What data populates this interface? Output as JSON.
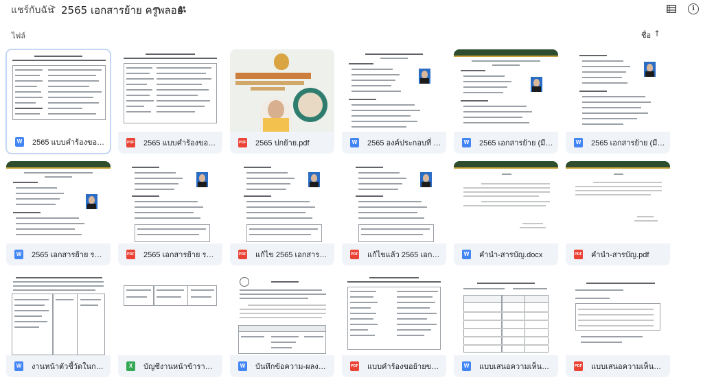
{
  "breadcrumb": {
    "root": "แชร์กับฉัน",
    "separator": ">",
    "current": "2565 เอกสารย้าย ครูพลอย"
  },
  "toolbar": {
    "shared_icon": "people-icon",
    "view_icon": "list-view-icon",
    "info_icon": "info-icon",
    "info_glyph": "i"
  },
  "section": {
    "label": "ไฟล์",
    "sort_label": "ชื่อ",
    "sort_arrow": "↑"
  },
  "file_types": {
    "doc": "W",
    "pdf": "PDF",
    "xls": "X"
  },
  "colors": {
    "doc": "#4285f4",
    "pdf": "#ea4335",
    "xls": "#34a853",
    "selected_border": "#c2d6f5"
  },
  "files": [
    {
      "name": "2565 แบบคำร้องขอย้ายของ...",
      "type": "W"
    },
    {
      "name": "2565 แบบคำร้องขอย้ายของ...",
      "type": "PDF"
    },
    {
      "name": "2565 ปกย้าย.pdf",
      "type": "PDF"
    },
    {
      "name": "2565 องค์ประกอบที่ 1-7 ครู...",
      "type": "W"
    },
    {
      "name": "2565 เอกสารย้าย (มีภาคผน...",
      "type": "W"
    },
    {
      "name": "2565 เอกสารย้าย (มีภาคผน...",
      "type": "W"
    },
    {
      "name": "2565 เอกสารย้าย รอ.3 ครูพ...",
      "type": "W"
    },
    {
      "name": "2565 เอกสารย้าย รอ.3 ครูพ...",
      "type": "PDF"
    },
    {
      "name": "แก้ไข 2565 เอกสารย้าย รอ....",
      "type": "PDF"
    },
    {
      "name": "แก้ไขแล้ว 2565 เอกสารย้าย ...",
      "type": "PDF"
    },
    {
      "name": "คำนำ-สารบัญ.docx",
      "type": "W"
    },
    {
      "name": "คำนำ-สารบัญ.pdf",
      "type": "PDF"
    },
    {
      "name": "งานหน้าตัวชี้วัดในการประเมิน...",
      "type": "W"
    },
    {
      "name": "บัญชีงานหน้าข้าราชการครูแล...",
      "type": "X"
    },
    {
      "name": "บันทึกข้อความ-ผลงาน-ข้อ-1...",
      "type": "W"
    },
    {
      "name": "แบบคำร้องขอย้ายของข้าราช...",
      "type": "PDF"
    },
    {
      "name": "แบบเสนอความเห็นคณะกรรม...",
      "type": "W"
    },
    {
      "name": "แบบเสนอความเห็นคณะกรรม...",
      "type": "PDF"
    }
  ]
}
